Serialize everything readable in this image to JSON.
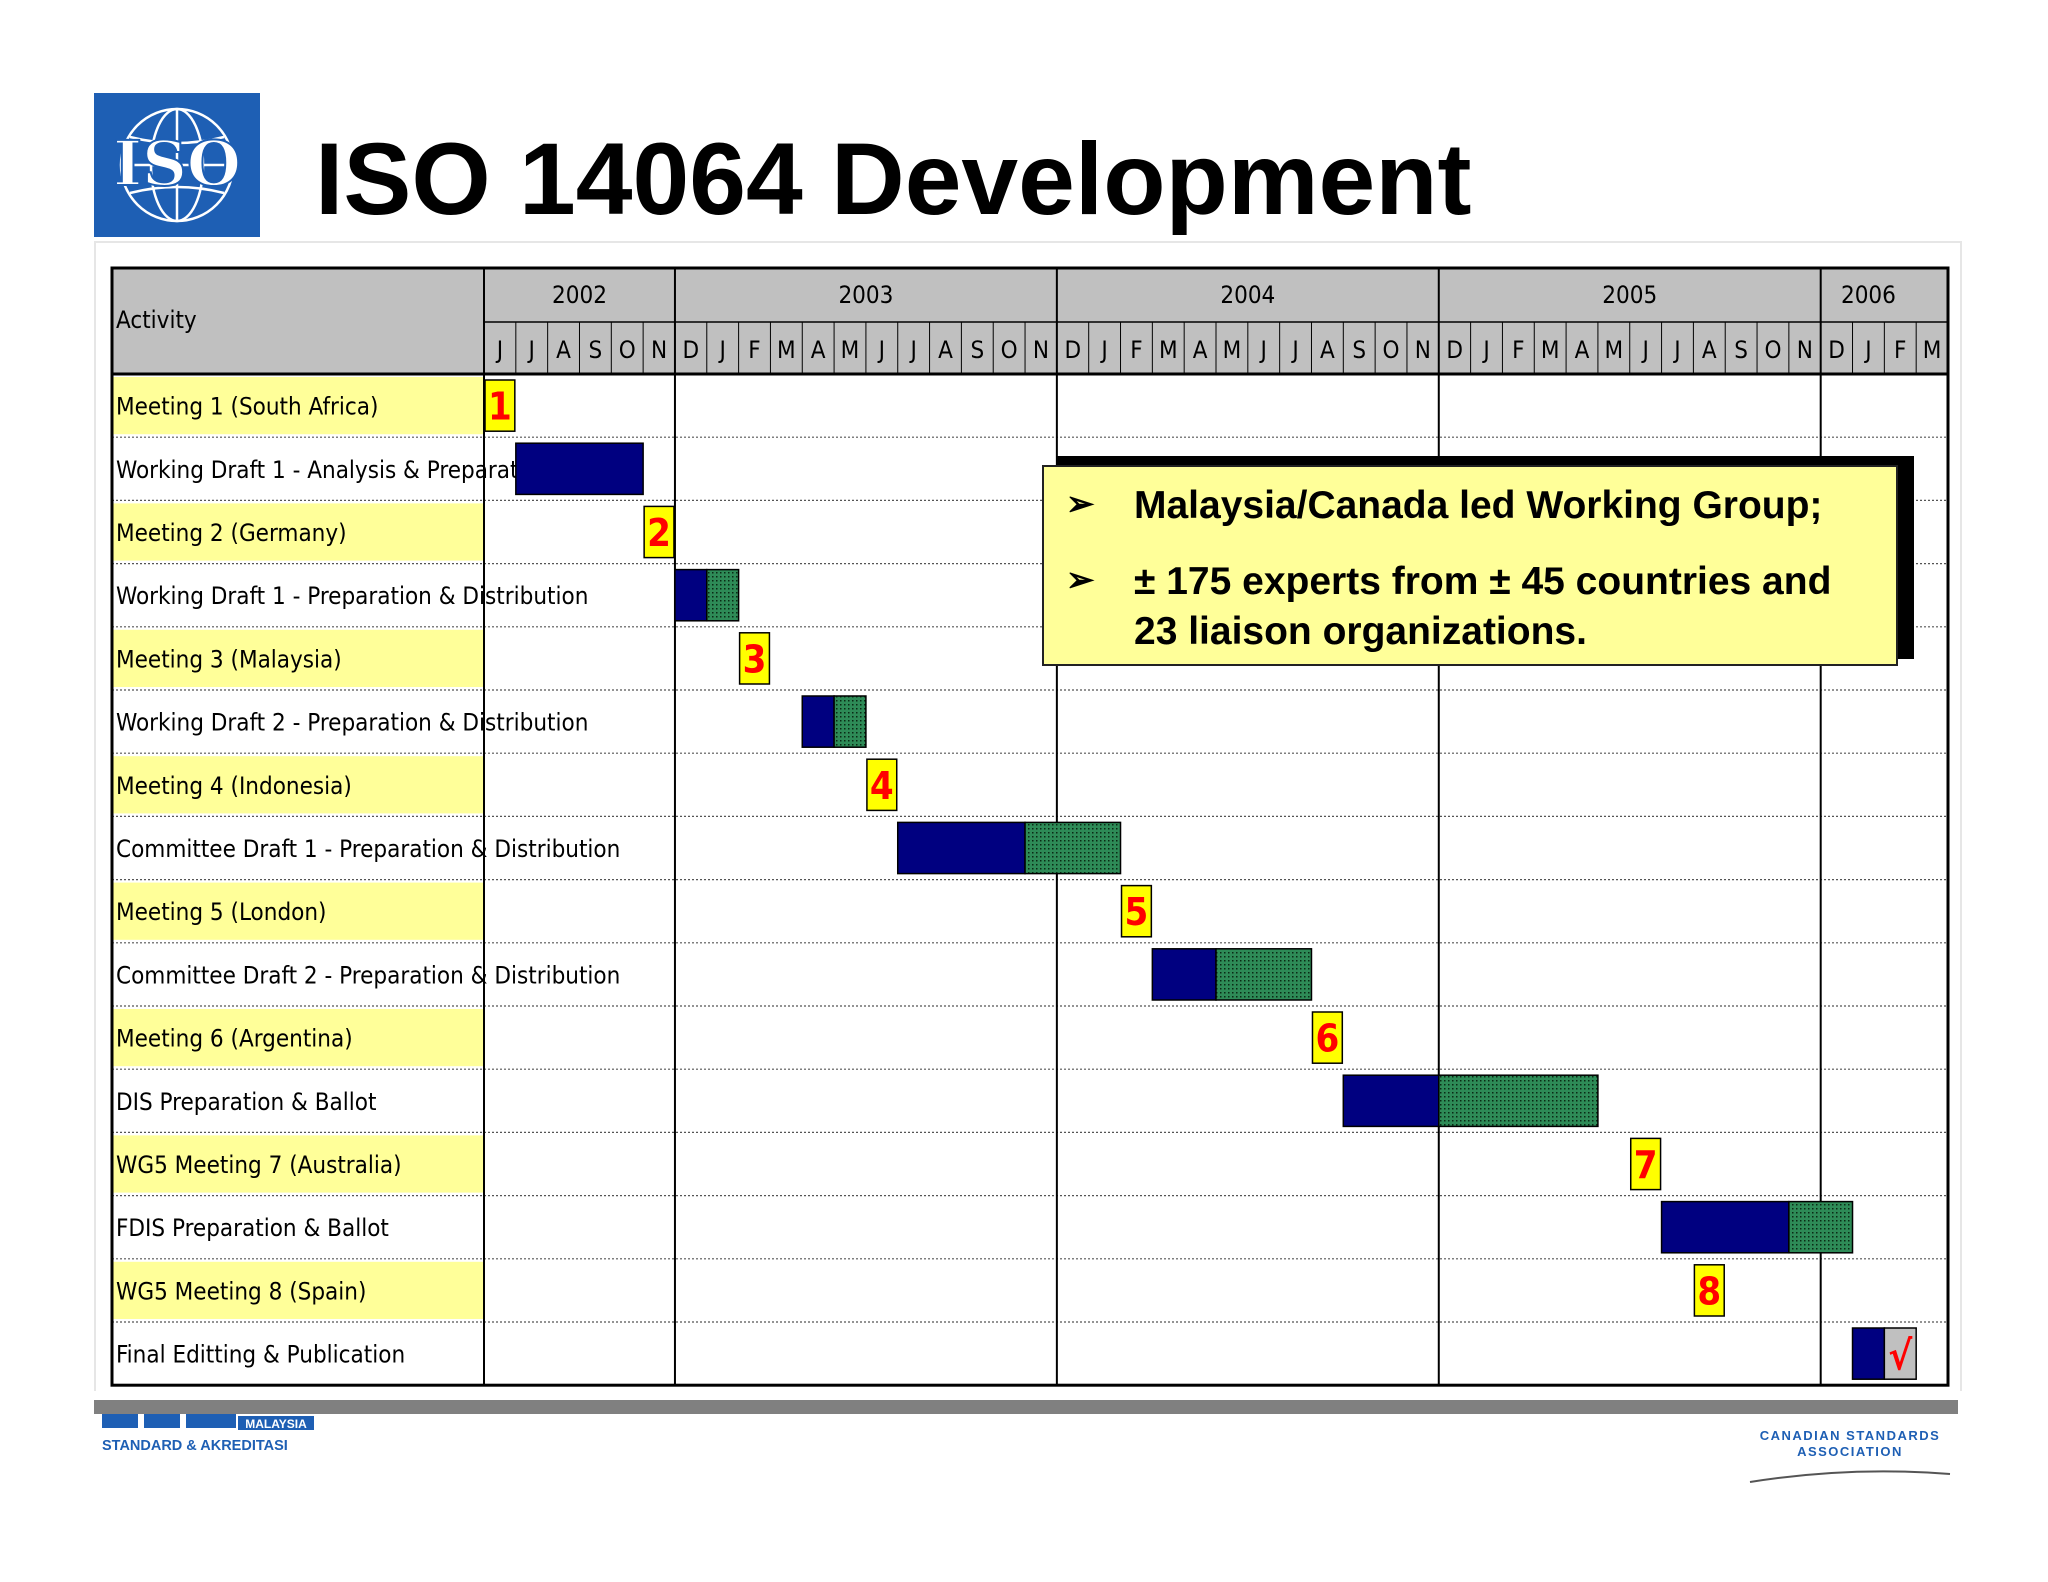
{
  "title": "ISO 14064 Development",
  "iso_logo": {
    "text": "ISO",
    "color": "#1e5fb4"
  },
  "callout": {
    "lines": [
      "Malaysia/Canada led Working Group;",
      "± 175 experts from ± 45 countries and 23 liaison organizations."
    ]
  },
  "footer": {
    "left_logo_text": "MALAYSIA",
    "left_logo_subtext": "STANDARD & AKREDITASI",
    "right_logo_line1": "CANADIAN STANDARDS",
    "right_logo_line2": "ASSOCIATION"
  },
  "colors": {
    "header_bg": "#c0c0c0",
    "meeting_bg": "#ffff99",
    "prep_bar": "#000080",
    "distribution_bar": "#2e8b57",
    "milestone_fill": "#ffff00",
    "milestone_text": "#ff0000",
    "final_check_bg": "#c0c0c0"
  },
  "chart_data": {
    "type": "table",
    "activity_header": "Activity",
    "years": [
      {
        "label": "2002",
        "months": 6
      },
      {
        "label": "2003",
        "months": 12
      },
      {
        "label": "2004",
        "months": 12
      },
      {
        "label": "2005",
        "months": 12
      },
      {
        "label": "2006",
        "months": 3
      }
    ],
    "months": [
      "J",
      "J",
      "A",
      "S",
      "O",
      "N",
      "D",
      "J",
      "F",
      "M",
      "A",
      "M",
      "J",
      "J",
      "A",
      "S",
      "O",
      "N",
      "D",
      "J",
      "F",
      "M",
      "A",
      "M",
      "J",
      "J",
      "A",
      "S",
      "O",
      "N",
      "D",
      "J",
      "F",
      "M",
      "A",
      "M",
      "J",
      "J",
      "A",
      "S",
      "O",
      "N",
      "D",
      "J",
      "F",
      "M"
    ],
    "rows": [
      {
        "label": "Meeting 1 (South Africa)",
        "kind": "meeting",
        "milestone": "1",
        "month": "2002-07"
      },
      {
        "label": "Working Draft 1 - Analysis & Preparation",
        "kind": "task",
        "prep": [
          "2002-08",
          "2002-11"
        ],
        "dist": null
      },
      {
        "label": "Meeting 2 (Germany)",
        "kind": "meeting",
        "milestone": "2",
        "month": "2002-12"
      },
      {
        "label": "Working Draft 1 - Preparation & Distribution",
        "kind": "task",
        "prep": [
          "2003-01",
          "2003-01"
        ],
        "dist": [
          "2003-02",
          "2003-02"
        ]
      },
      {
        "label": "Meeting 3 (Malaysia)",
        "kind": "meeting",
        "milestone": "3",
        "month": "2003-03"
      },
      {
        "label": "Working Draft 2 - Preparation & Distribution",
        "kind": "task",
        "prep": [
          "2003-05",
          "2003-05"
        ],
        "dist": [
          "2003-06",
          "2003-06"
        ]
      },
      {
        "label": "Meeting 4 (Indonesia)",
        "kind": "meeting",
        "milestone": "4",
        "month": "2003-07"
      },
      {
        "label": "Committee Draft 1 - Preparation & Distribution",
        "kind": "task",
        "prep": [
          "2003-08",
          "2003-11"
        ],
        "dist": [
          "2003-12",
          "2004-02"
        ]
      },
      {
        "label": "Meeting 5 (London)",
        "kind": "meeting",
        "milestone": "5",
        "month": "2004-03"
      },
      {
        "label": "Committee Draft 2 - Preparation & Distribution",
        "kind": "task",
        "prep": [
          "2004-04",
          "2004-05"
        ],
        "dist": [
          "2004-06",
          "2004-08"
        ]
      },
      {
        "label": "Meeting 6 (Argentina)",
        "kind": "meeting",
        "milestone": "6",
        "month": "2004-09"
      },
      {
        "label": "DIS Preparation & Ballot",
        "kind": "task",
        "prep": [
          "2004-10",
          "2004-12"
        ],
        "dist": [
          "2005-01",
          "2005-05"
        ]
      },
      {
        "label": "WG5 Meeting 7 (Australia)",
        "kind": "meeting",
        "milestone": "7",
        "month": "2005-07"
      },
      {
        "label": "FDIS Preparation & Ballot",
        "kind": "task",
        "prep": [
          "2005-08",
          "2005-11"
        ],
        "dist": [
          "2005-12",
          "2006-01"
        ]
      },
      {
        "label": "WG5 Meeting 8 (Spain)",
        "kind": "meeting",
        "milestone": "8",
        "month": "2005-09"
      },
      {
        "label": "Final Editting & Publication",
        "kind": "task",
        "prep": [
          "2006-02",
          "2006-02"
        ],
        "dist": null,
        "check": "√",
        "check_month": "2006-03"
      }
    ]
  }
}
